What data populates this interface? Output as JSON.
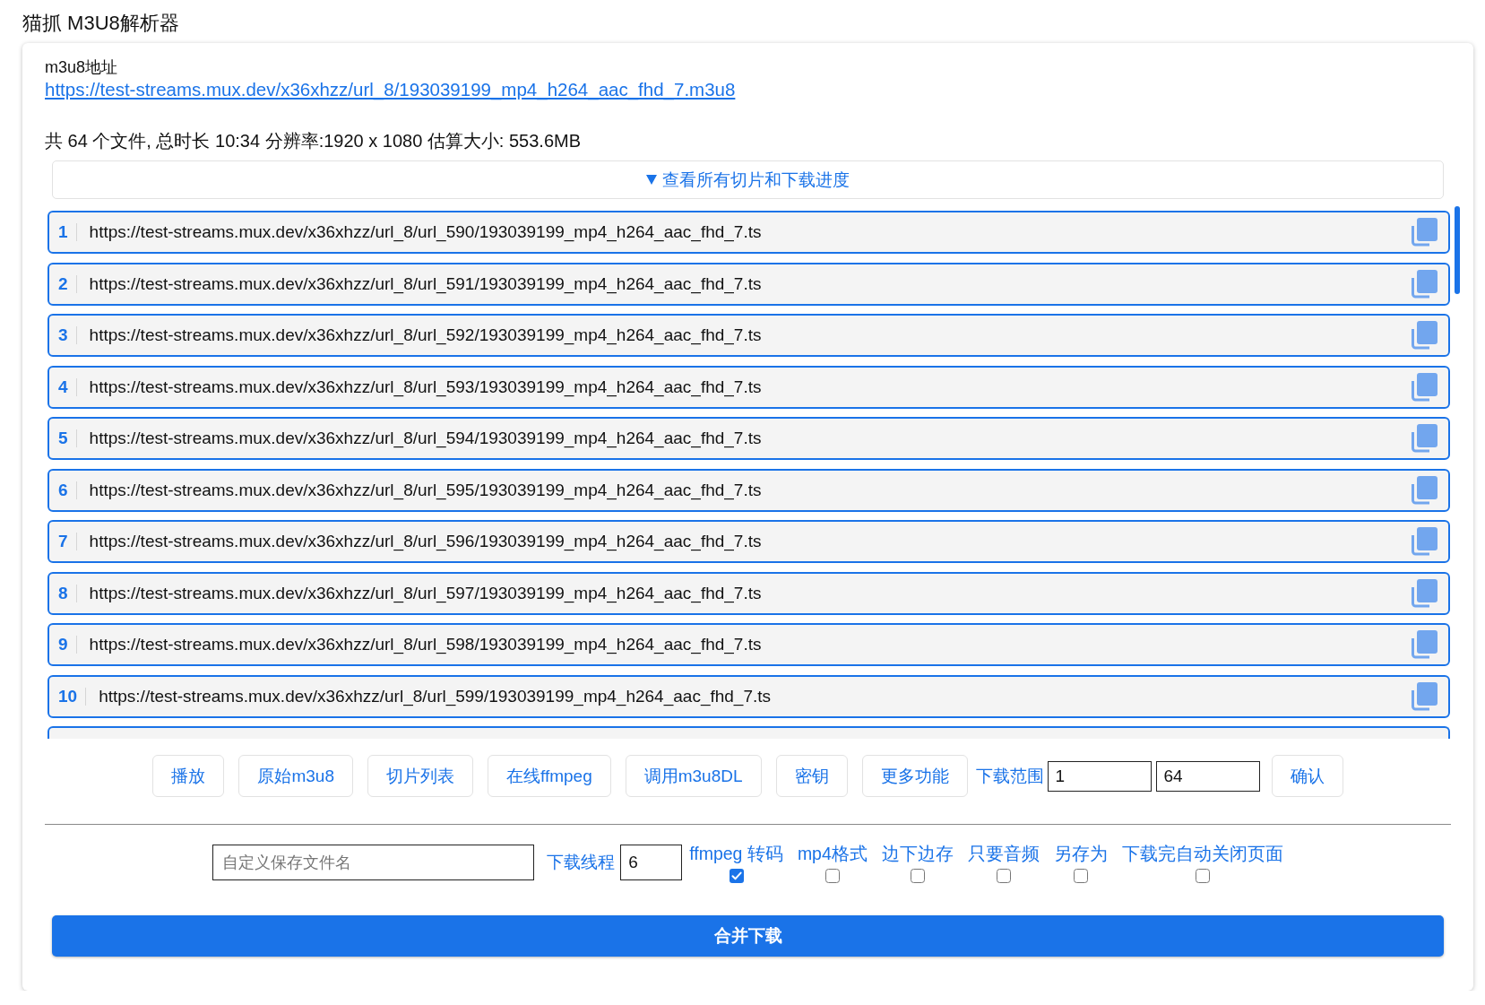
{
  "app_title": "猫抓 M3U8解析器",
  "source": {
    "label": "m3u8地址",
    "url": "https://test-streams.mux.dev/x36xhzz/url_8/193039199_mp4_h264_aac_fhd_7.m3u8"
  },
  "summary": "共 64 个文件, 总时长 10:34 分辨率:1920 x 1080 估算大小: 553.6MB",
  "segments_toggle": {
    "label": "查看所有切片和下载进度",
    "expanded": true
  },
  "segments": [
    {
      "index": "1",
      "url": "https://test-streams.mux.dev/x36xhzz/url_8/url_590/193039199_mp4_h264_aac_fhd_7.ts"
    },
    {
      "index": "2",
      "url": "https://test-streams.mux.dev/x36xhzz/url_8/url_591/193039199_mp4_h264_aac_fhd_7.ts"
    },
    {
      "index": "3",
      "url": "https://test-streams.mux.dev/x36xhzz/url_8/url_592/193039199_mp4_h264_aac_fhd_7.ts"
    },
    {
      "index": "4",
      "url": "https://test-streams.mux.dev/x36xhzz/url_8/url_593/193039199_mp4_h264_aac_fhd_7.ts"
    },
    {
      "index": "5",
      "url": "https://test-streams.mux.dev/x36xhzz/url_8/url_594/193039199_mp4_h264_aac_fhd_7.ts"
    },
    {
      "index": "6",
      "url": "https://test-streams.mux.dev/x36xhzz/url_8/url_595/193039199_mp4_h264_aac_fhd_7.ts"
    },
    {
      "index": "7",
      "url": "https://test-streams.mux.dev/x36xhzz/url_8/url_596/193039199_mp4_h264_aac_fhd_7.ts"
    },
    {
      "index": "8",
      "url": "https://test-streams.mux.dev/x36xhzz/url_8/url_597/193039199_mp4_h264_aac_fhd_7.ts"
    },
    {
      "index": "9",
      "url": "https://test-streams.mux.dev/x36xhzz/url_8/url_598/193039199_mp4_h264_aac_fhd_7.ts"
    },
    {
      "index": "10",
      "url": "https://test-streams.mux.dev/x36xhzz/url_8/url_599/193039199_mp4_h264_aac_fhd_7.ts"
    }
  ],
  "segments_more_below": true,
  "toolbar": {
    "buttons": [
      "播放",
      "原始m3u8",
      "切片列表",
      "在线ffmpeg",
      "调用m3u8DL",
      "密钥",
      "更多功能"
    ],
    "range": {
      "label": "下载范围",
      "start": "1",
      "end": "64"
    },
    "confirm_button": "确认"
  },
  "download_options": {
    "filename": {
      "placeholder": "自定义保存文件名"
    },
    "threads": {
      "label": "下载线程",
      "value": "6"
    },
    "switches": [
      {
        "label": "ffmpeg 转码",
        "checked": true
      },
      {
        "label": "mp4格式",
        "checked": false
      },
      {
        "label": "边下边存",
        "checked": false
      },
      {
        "label": "只要音频",
        "checked": false
      },
      {
        "label": "另存为",
        "checked": false
      },
      {
        "label": "下载完自动关闭页面",
        "checked": false
      }
    ]
  },
  "merge_button": "合并下载"
}
